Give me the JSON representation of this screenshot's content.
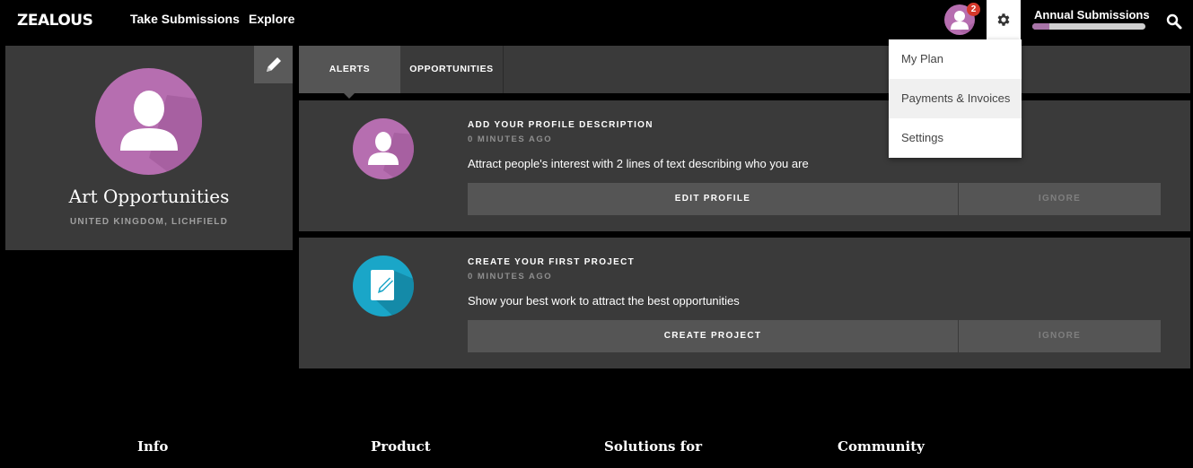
{
  "brand": {
    "logo": "ZEALOUS"
  },
  "nav": {
    "take_submissions": "Take Submissions",
    "explore": "Explore"
  },
  "user_menu": {
    "notification_count": "2",
    "annual_submissions_label": "Annual Submissions",
    "annual_submissions_progress_fraction": 0.15,
    "accent_color": "#a874a8"
  },
  "settings_dropdown": {
    "items": [
      {
        "label": "My Plan"
      },
      {
        "label": "Payments & Invoices"
      },
      {
        "label": "Settings"
      }
    ]
  },
  "profile": {
    "name": "Art Opportunities",
    "location": "UNITED KINGDOM, LICHFIELD",
    "avatar_color": "#b66eb0"
  },
  "tabs": [
    {
      "label": "ALERTS",
      "active": true
    },
    {
      "label": "OPPORTUNITIES",
      "active": false
    }
  ],
  "alerts": [
    {
      "icon": "user-silhouette-icon",
      "title": "ADD YOUR PROFILE DESCRIPTION",
      "time": "0 MINUTES AGO",
      "description": "Attract people's interest with 2 lines of text describing who you are",
      "primary_action": "EDIT PROFILE",
      "secondary_action": "IGNORE"
    },
    {
      "icon": "edit-document-icon",
      "title": "CREATE YOUR FIRST PROJECT",
      "time": "0 MINUTES AGO",
      "description": "Show your best work to attract the best opportunities",
      "primary_action": "CREATE PROJECT",
      "secondary_action": "IGNORE"
    }
  ],
  "footer": {
    "columns": [
      {
        "heading": "Info"
      },
      {
        "heading": "Product"
      },
      {
        "heading": "Solutions for"
      },
      {
        "heading": "Community"
      }
    ]
  },
  "colors": {
    "background": "#000000",
    "panel": "#3a3a3a",
    "button": "#555555",
    "purple": "#b66eb0",
    "teal": "#1aa6c8",
    "badge_red": "#d6392c"
  }
}
